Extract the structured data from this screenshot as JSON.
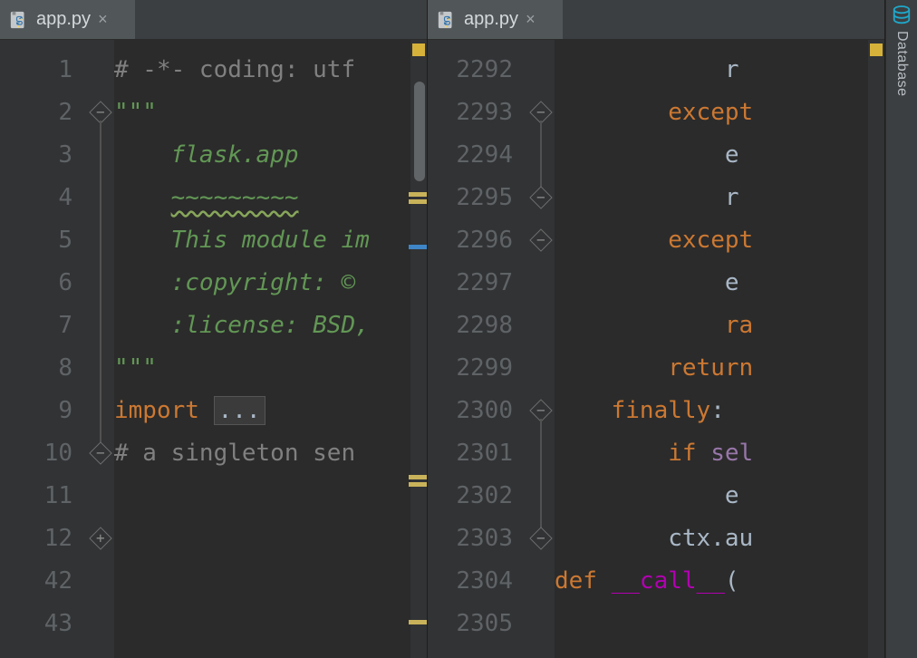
{
  "left": {
    "tab": {
      "filename": "app.py",
      "close_glyph": "×"
    },
    "lines": [
      {
        "n": "1",
        "html": "<span class='c-comment'># -*- coding: utf</span>"
      },
      {
        "n": "2",
        "html": "<span class='c-docq'>\"\"\"</span>",
        "fold": "minus"
      },
      {
        "n": "3",
        "html": "<span class='c-doc'>    flask.app</span>"
      },
      {
        "n": "4",
        "html": "<span class='c-doc'>    <span class='wavy'>~~~~~~~~~</span></span>"
      },
      {
        "n": "5",
        "html": ""
      },
      {
        "n": "6",
        "html": "<span class='c-doc'>    This module im</span>"
      },
      {
        "n": "7",
        "html": ""
      },
      {
        "n": "8",
        "html": "<span class='c-doc'>    :copyright: © </span>"
      },
      {
        "n": "9",
        "html": "<span class='c-doc'>    :license: BSD,</span>"
      },
      {
        "n": "10",
        "html": "<span class='c-docq'>\"\"\"</span>",
        "fold": "minus_end"
      },
      {
        "n": "11",
        "html": ""
      },
      {
        "n": "12",
        "html": "<span class='c-kw'>import</span> <span class='folded'>...</span>",
        "fold": "plus"
      },
      {
        "n": "42",
        "html": ""
      },
      {
        "n": "43",
        "html": "<span class='c-comment'># a singleton sen</span>"
      }
    ]
  },
  "right": {
    "tab": {
      "filename": "app.py",
      "close_glyph": "×"
    },
    "lines": [
      {
        "n": "2292",
        "html": "            r"
      },
      {
        "n": "2293",
        "html": "        <span class='c-kw'>except</span>",
        "fold": "minus"
      },
      {
        "n": "2294",
        "html": "            e"
      },
      {
        "n": "2295",
        "html": "            r",
        "fold": "minus_end"
      },
      {
        "n": "2296",
        "html": "        <span class='c-kw'>except</span>",
        "fold": "minus"
      },
      {
        "n": "2297",
        "html": "            e"
      },
      {
        "n": "2298",
        "html": "            <span class='c-kw'>ra</span>"
      },
      {
        "n": "2299",
        "html": "        <span class='c-kw'>return</span>"
      },
      {
        "n": "2300",
        "html": "    <span class='c-kw'>finally</span><span class='c-ident'>:</span>",
        "fold": "minus"
      },
      {
        "n": "2301",
        "html": "        <span class='c-kw'>if</span> <span class='c-self'>sel</span>"
      },
      {
        "n": "2302",
        "html": "            e"
      },
      {
        "n": "2303",
        "html": "        ctx.au",
        "fold": "minus_end"
      },
      {
        "n": "2304",
        "html": ""
      },
      {
        "n": "2305",
        "html": "<span class='c-def'>def</span> <span class='c-dunder'>__call__</span>("
      }
    ]
  },
  "sideband": {
    "label": "Database"
  },
  "colors": {
    "bg": "#2b2b2b",
    "gutter": "#313335",
    "tabbar": "#3c3f41",
    "comment": "#808080",
    "docstring": "#629755",
    "keyword": "#cc7832",
    "dunder": "#b200b2"
  }
}
